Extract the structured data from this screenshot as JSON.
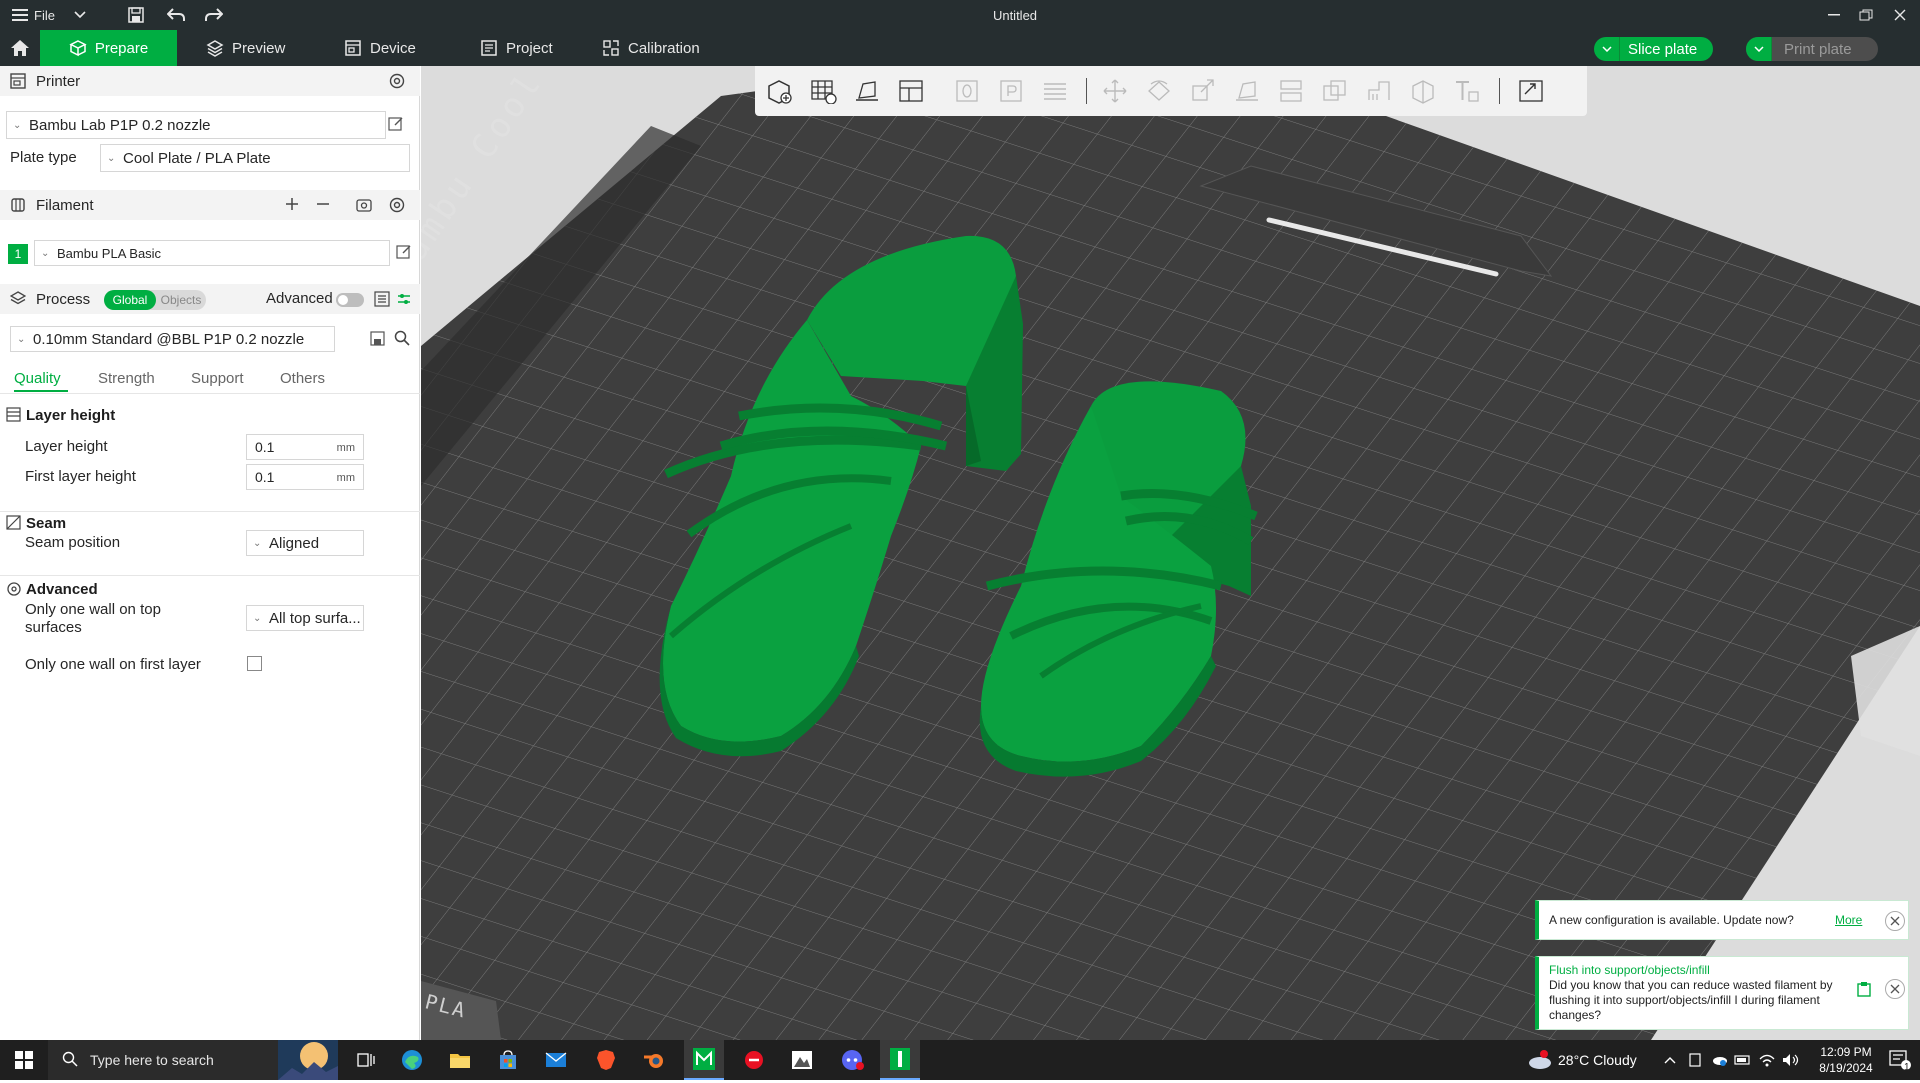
{
  "titlebar": {
    "menu_label": "File",
    "title": "Untitled"
  },
  "tabs": [
    {
      "label": "Prepare",
      "icon": "cube-icon",
      "active": true
    },
    {
      "label": "Preview",
      "icon": "layers-icon"
    },
    {
      "label": "Device",
      "icon": "device-icon"
    },
    {
      "label": "Project",
      "icon": "project-icon"
    },
    {
      "label": "Calibration",
      "icon": "calibration-icon"
    }
  ],
  "actions": {
    "slice_label": "Slice plate",
    "print_label": "Print plate"
  },
  "printer": {
    "section_title": "Printer",
    "selected": "Bambu Lab P1P 0.2 nozzle",
    "plate_type_label": "Plate type",
    "plate_type_value": "Cool Plate / PLA Plate"
  },
  "filament": {
    "section_title": "Filament",
    "slot_number": "1",
    "slot_color": "#00ae42",
    "selected": "Bambu PLA Basic"
  },
  "process": {
    "section_title": "Process",
    "toggle_global": "Global",
    "toggle_objects": "Objects",
    "advanced_label": "Advanced",
    "advanced_on": false,
    "preset": "0.10mm Standard @BBL P1P 0.2 nozzle",
    "tabs": [
      "Quality",
      "Strength",
      "Support",
      "Others"
    ],
    "active_tab": "Quality"
  },
  "settings": {
    "layer_height_cat": "Layer height",
    "layer_height_label": "Layer height",
    "layer_height_value": "0.1",
    "first_layer_height_label": "First layer height",
    "first_layer_height_value": "0.1",
    "unit": "mm",
    "seam_cat": "Seam",
    "seam_position_label": "Seam position",
    "seam_position_value": "Aligned",
    "advanced_cat": "Advanced",
    "one_wall_top_label": "Only one wall on top surfaces",
    "one_wall_top_value": "All top surfa...",
    "one_wall_first_label": "Only one wall on first layer",
    "one_wall_first_checked": false
  },
  "plate": {
    "brand_text": "Bambu Cool Plate",
    "corner_text": "PLA"
  },
  "notifications": [
    {
      "text": "A new configuration is available. Update now?",
      "link": "More"
    },
    {
      "title": "Flush into support/objects/infill",
      "body": "Did you know that you can reduce wasted filament by flushing it into support/objects/infill I during filament changes?"
    }
  ],
  "taskbar": {
    "search_placeholder": "Type here to search",
    "weather": "28°C  Cloudy",
    "time": "12:09 PM",
    "date": "8/19/2024",
    "notification_count": "1"
  },
  "colors": {
    "brand_green": "#00ae42",
    "bar_dark": "#262e30",
    "model_green": "#089a3c"
  }
}
